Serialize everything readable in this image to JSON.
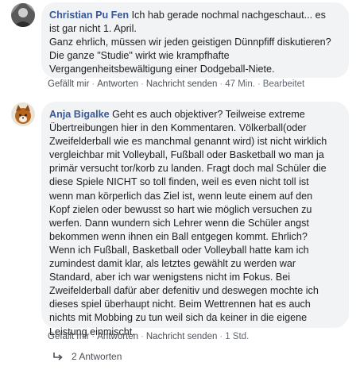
{
  "comments": [
    {
      "author": "Christian Pu Fen",
      "lines": [
        "Ich hab gerade nochmal nachgeschaut... es",
        "ist gar nicht 1. April.",
        "Ganz ehrlich, müssen wir jeden geistigen Dünnpfiff diskutieren?",
        "Die ganze \"Studie\" wirkt wie krampfhafte",
        "Vergangenheitsbewältigung einer Dodgeball-Niete."
      ],
      "actions": {
        "like": "Gefällt mir",
        "reply": "Antworten",
        "message": "Nachricht senden",
        "time": "47 Min.",
        "edited": "Bearbeitet"
      }
    },
    {
      "author": "Anja Bigalke",
      "lines": [
        "Geht es auch objektiver? Teilweise extreme",
        "Übertreibungen hier in den Kommentaren. Völkerball(oder",
        "Zweifelderball wie es manchmal genannt wird) ist nicht wirklich",
        "vergleichbar mit Volleyball, Fußball oder Basketball wo man ja",
        "primär versucht tor/korb zu landen. Fragt doch mal Schüler die",
        "diese Spiele NICHT so toll finden, weil es even nicht toll ist",
        "wenn man körperlich das Ziel ist, wenn leute einem auf den",
        "Kopf zielen oder bewusst so hart wie möglich versuchen zu",
        "werfen. Dann wundern sich Lehrer wenn die Schüler angst",
        "bekommen wenn ihnen ein Ball entgegen kommt. Ehrlich?",
        "Wenn ich Fußball, Basketball oder Volleyball hatte kam ich",
        "zumindest damit klar, als letztes gewählt zu werden war",
        "Standard, aber ich war wenigstens nicht im Fokus. Bei",
        "Zweifelderball dafür aber defenitiv und deswegen mochte ich",
        "dieses spiel überhaupt nicht. Beim Wettrennen hat es auch",
        "nichts mit Mobbing zu tun weil sich da keiner in die eigene",
        "Leistung einmischt."
      ],
      "actions": {
        "like": "Gefällt mir",
        "reply": "Antworten",
        "message": "Nachricht senden",
        "time": "1 Std."
      }
    }
  ],
  "replies": {
    "label": "2 Antworten",
    "icon": "reply-arrow-icon"
  },
  "colors": {
    "author": "#385898",
    "bubble": "#f2f3f5",
    "meta": "#606770"
  }
}
